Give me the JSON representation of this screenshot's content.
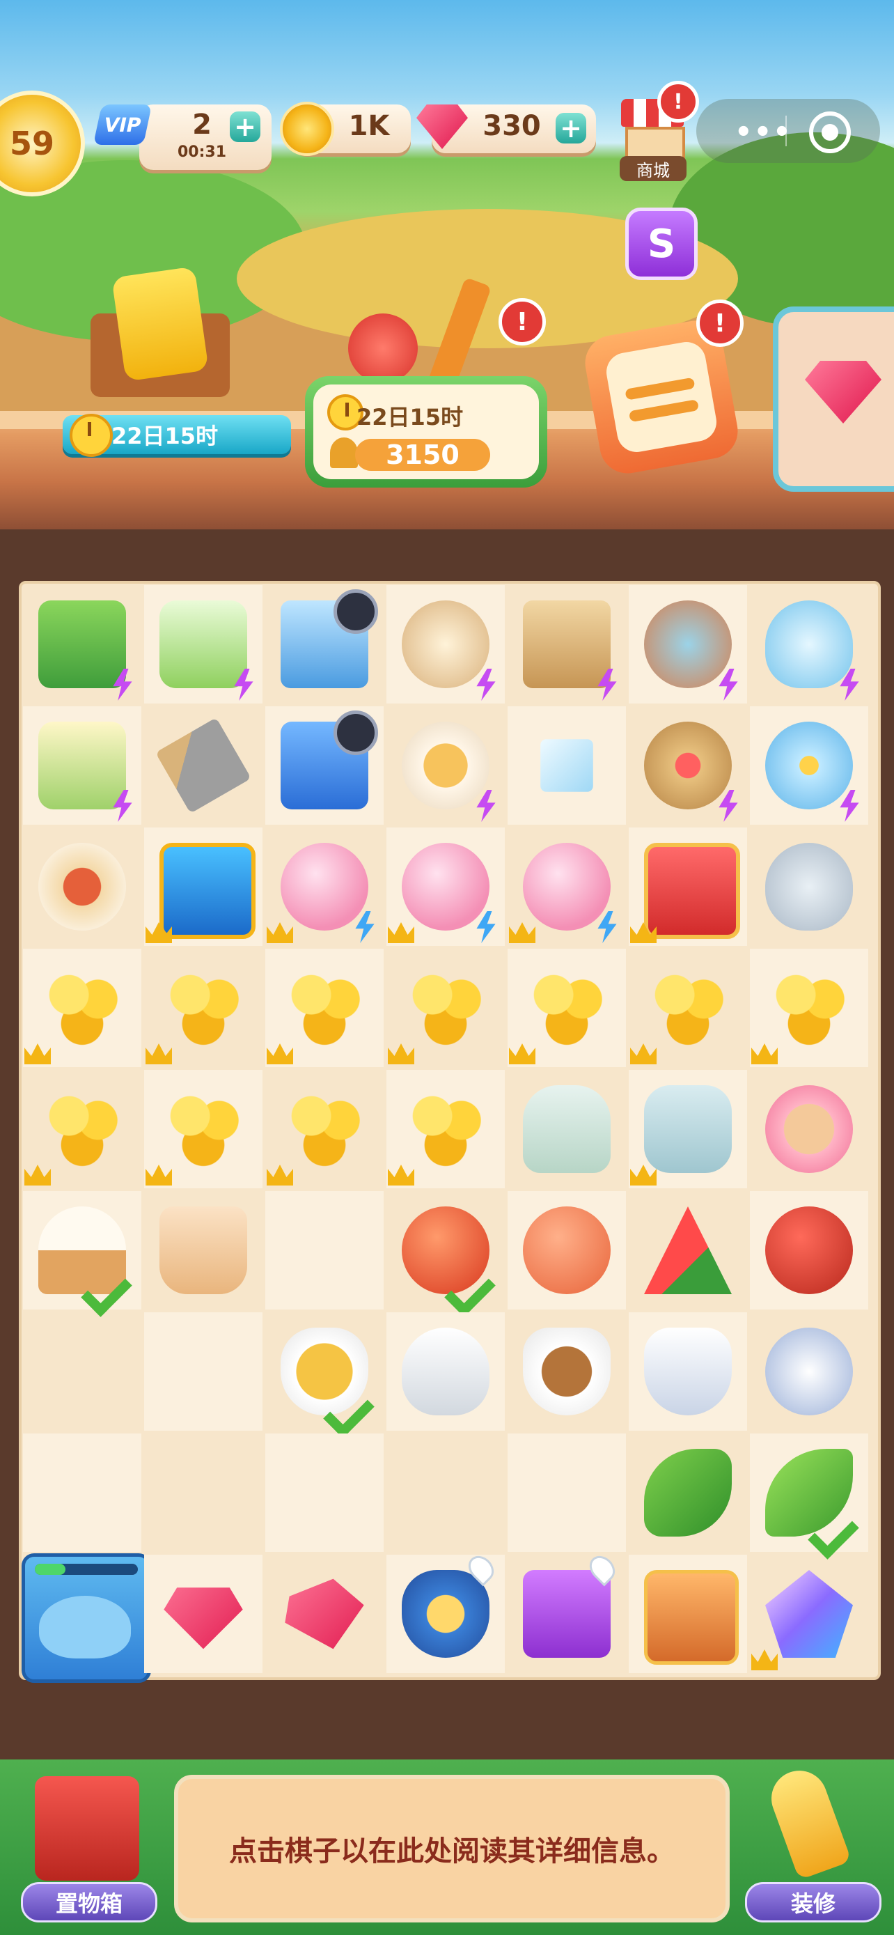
{
  "hud": {
    "level": "59",
    "vip_label": "VIP",
    "energy_value": "2",
    "energy_timer": "00:31",
    "coins": "1K",
    "gems": "330",
    "shop_label": "商城",
    "menu_dots": "•••",
    "alert_mark": "!",
    "plus": "+"
  },
  "scene": {
    "crate_timer": "22日15时",
    "quest_timer": "22日15时",
    "quest_points": "3150",
    "purple_button_glyph": "S"
  },
  "board": {
    "columns": 7,
    "rows": 9,
    "cells": [
      [
        "coffee-machine",
        "juicer",
        "ice-cooler",
        "rice-cooker",
        "picnic-basket",
        "clay-pot",
        "fish-bowl"
      ],
      [
        "blender",
        "spatula",
        "mini-fridge",
        "soup-bowl",
        "ice-cube",
        "cherry-basket",
        "fish-bowl-small"
      ],
      [
        "pizza-plate",
        "blue-chest",
        "piggy-bank",
        "piggy-bank",
        "piggy-bank",
        "red-chest",
        "porcelain-bowl"
      ],
      [
        "coins",
        "coins",
        "coins",
        "coins",
        "coins",
        "coins",
        "coins"
      ],
      [
        "coins",
        "coins",
        "coins",
        "coins",
        "sake-bottle",
        "sake-set",
        "noodle-bowl"
      ],
      [
        "ice-cream",
        "fan",
        "",
        "apple",
        "peach",
        "watermelon",
        "pomegranate"
      ],
      [
        "",
        "",
        "tea-cup",
        "tea-gaiwan",
        "tea-mug",
        "tea-cup-saucer",
        "tea-pot"
      ],
      [
        "",
        "",
        "",
        "",
        "",
        "peas",
        "okra"
      ],
      [
        "dolphin",
        "ruby-small",
        "ruby-pair",
        "gift-sack",
        "purple-chest",
        "treasure-chest",
        "crystal"
      ]
    ],
    "dolphin_progress": 0.3
  },
  "bottom": {
    "info_text": "点击棋子以在此处阅读其详细信息。",
    "storage_label": "置物箱",
    "decorate_label": "装修"
  },
  "colors": {
    "board_bg": "#f7e6cb",
    "accent_green": "#4fb04f",
    "accent_purple": "#5e47b8"
  }
}
